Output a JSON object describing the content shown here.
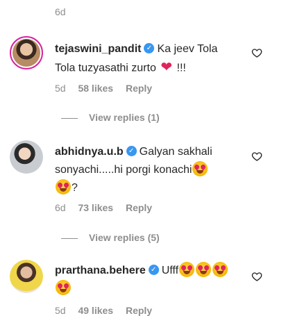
{
  "top_meta": {
    "time": "6d"
  },
  "comments": [
    {
      "username": "tejaswini_pandit",
      "text_line1": "Ka jeev Tola",
      "text_line2_prefix": "Tola tuzyasathi zurto",
      "text_line2_suffix": "!!!",
      "time": "5d",
      "likes": "58 likes",
      "reply": "Reply",
      "view_replies": "View replies (1)"
    },
    {
      "username": "abhidnya.u.b",
      "text_line1": "Galyan sakhali",
      "text_line2": "sonyachi.....hi porgi konachi",
      "text_line3_suffix": "?",
      "time": "6d",
      "likes": "73 likes",
      "reply": "Reply",
      "view_replies": "View replies (5)"
    },
    {
      "username": "prarthana.behere",
      "text_line1": "Ufff",
      "time": "5d",
      "likes": "49 likes",
      "reply": "Reply"
    }
  ],
  "colors": {
    "verified": "#3897f0",
    "muted": "#8e8e8e",
    "text": "#262626",
    "story_ring": "#d6249f"
  },
  "icons": {
    "like": "heart-outline-icon",
    "verified": "verified-badge-icon",
    "emoji": "heart-eyes-emoji",
    "red_heart": "red-heart-emoji"
  }
}
